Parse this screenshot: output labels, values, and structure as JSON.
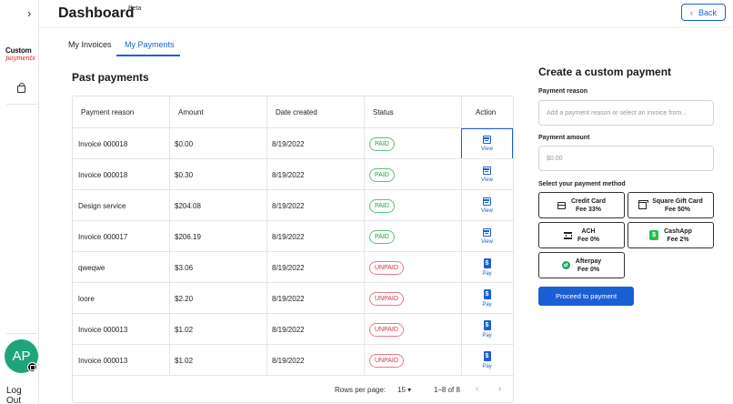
{
  "rail": {
    "logo_line1": "Custom",
    "logo_line2": "payments",
    "avatar_initials": "AP",
    "logout": "Log Out"
  },
  "header": {
    "title": "Dashboard",
    "badge": "Beta",
    "back_label": "Back"
  },
  "tabs": [
    {
      "label": "My Invoices",
      "active": false
    },
    {
      "label": "My Payments",
      "active": true
    }
  ],
  "past_payments": {
    "heading": "Past payments",
    "columns": [
      "Payment reason",
      "Amount",
      "Date created",
      "Status",
      "Action"
    ],
    "rows": [
      {
        "reason": "Invoice 000018",
        "amount": "$0.00",
        "date": "8/19/2022",
        "status": "PAID",
        "action": "View"
      },
      {
        "reason": "Invoice 000018",
        "amount": "$0.30",
        "date": "8/19/2022",
        "status": "PAID",
        "action": "View"
      },
      {
        "reason": "Design service",
        "amount": "$204.08",
        "date": "8/19/2022",
        "status": "PAID",
        "action": "View"
      },
      {
        "reason": "Invoice 000017",
        "amount": "$206.19",
        "date": "8/19/2022",
        "status": "PAID",
        "action": "View"
      },
      {
        "reason": "qweqwe",
        "amount": "$3.06",
        "date": "8/19/2022",
        "status": "UNPAID",
        "action": "Pay"
      },
      {
        "reason": "loore",
        "amount": "$2.20",
        "date": "8/19/2022",
        "status": "UNPAID",
        "action": "Pay"
      },
      {
        "reason": "Invoice 000013",
        "amount": "$1.02",
        "date": "8/19/2022",
        "status": "UNPAID",
        "action": "Pay"
      },
      {
        "reason": "Invoice 000013",
        "amount": "$1.02",
        "date": "8/19/2022",
        "status": "UNPAID",
        "action": "Pay"
      }
    ],
    "footer": {
      "rows_per_page_label": "Rows per page:",
      "rows_per_page_value": "15",
      "range": "1–8 of 8"
    }
  },
  "custom_payment": {
    "heading": "Create a custom payment",
    "reason_label": "Payment reason",
    "reason_placeholder": "Add a payment reason or select an invoice from...",
    "amount_label": "Payment amount",
    "amount_placeholder": "$0.00",
    "method_label": "Select your payment method",
    "methods": [
      {
        "name": "Credit Card",
        "fee": "Fee 33%"
      },
      {
        "name": "Square Gift Card",
        "fee": "Fee 50%"
      },
      {
        "name": "ACH",
        "fee": "Fee 0%"
      },
      {
        "name": "CashApp",
        "fee": "Fee 2%"
      },
      {
        "name": "Afterpay",
        "fee": "Fee 0%"
      }
    ],
    "proceed_label": "Proceed to payment"
  },
  "colors": {
    "accent": "#1a5fd6",
    "paid": "#1f9b4a",
    "unpaid": "#d0344a",
    "avatar": "#1fa37a"
  }
}
